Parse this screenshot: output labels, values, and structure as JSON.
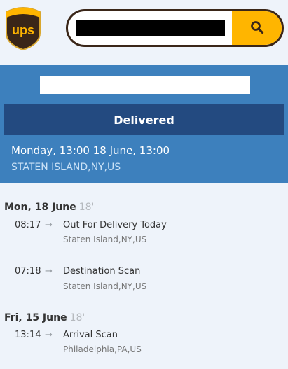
{
  "header": {
    "logo_text": "ups",
    "search": {
      "value": "",
      "placeholder": ""
    },
    "search_icon": "search-icon"
  },
  "colors": {
    "brand_yellow": "#ffb500",
    "brand_brown": "#3a2618",
    "panel_blue": "#3d80bd",
    "status_bar": "#234a80"
  },
  "summary": {
    "tracking_number": "",
    "status": "Delivered",
    "delivered_at": "Monday, 13:00 18 June, 13:00",
    "delivered_location": "STATEN ISLAND,NY,US"
  },
  "history": [
    {
      "date": "Mon, 18 June",
      "year": "18'",
      "events": [
        {
          "time": "08:17",
          "arrow": "→",
          "title": "Out For Delivery Today",
          "location": "Staten Island,NY,US"
        },
        {
          "time": "07:18",
          "arrow": "→",
          "title": "Destination Scan",
          "location": "Staten Island,NY,US"
        }
      ]
    },
    {
      "date": "Fri, 15 June",
      "year": "18'",
      "events": [
        {
          "time": "13:14",
          "arrow": "→",
          "title": "Arrival Scan",
          "location": "Philadelphia,PA,US"
        }
      ]
    }
  ]
}
